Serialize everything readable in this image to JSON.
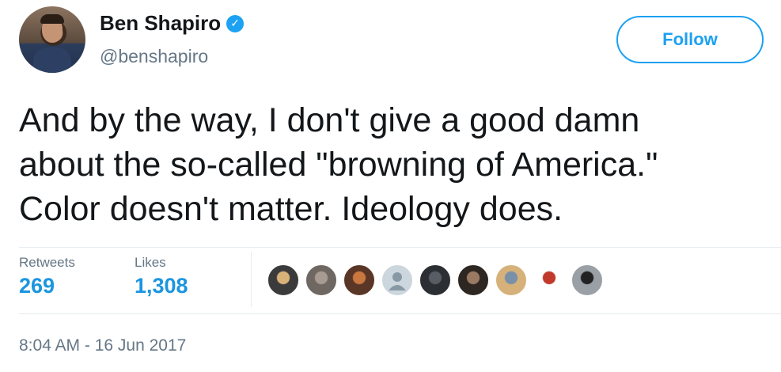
{
  "author": {
    "name": "Ben Shapiro",
    "handle": "@benshapiro",
    "verified_icon": "✓"
  },
  "follow_label": "Follow",
  "tweet_lines": [
    "And by the way, I don't give a good damn",
    "about the so-called \"browning of America.\"",
    "Color doesn't matter. Ideology does."
  ],
  "stats": {
    "retweets_label": "Retweets",
    "retweets_value": "269",
    "likes_label": "Likes",
    "likes_value": "1,308"
  },
  "likers": [
    {
      "icon": "liker-avatar-1",
      "color": "#3b3b3b",
      "accent": "#d9b27a"
    },
    {
      "icon": "liker-avatar-2",
      "color": "#6e6762",
      "accent": "#a89c92"
    },
    {
      "icon": "liker-avatar-3",
      "color": "#5a3626",
      "accent": "#c9763f"
    },
    {
      "icon": "default-user-icon",
      "color": "#ccd6dd",
      "accent": "#8899a6"
    },
    {
      "icon": "liker-avatar-5",
      "color": "#2b2e33",
      "accent": "#585d63"
    },
    {
      "icon": "liker-avatar-6",
      "color": "#2d2621",
      "accent": "#9a7a62"
    },
    {
      "icon": "liker-avatar-7",
      "color": "#d6b27a",
      "accent": "#7a8fa8"
    },
    {
      "icon": "liker-avatar-8",
      "color": "#ffffff",
      "accent": "#c0392b"
    },
    {
      "icon": "liker-avatar-9",
      "color": "#9aa0a6",
      "accent": "#222222"
    }
  ],
  "timestamp": "8:04 AM - 16 Jun 2017",
  "colors": {
    "accent": "#1da1f2",
    "count": "#1b95e0",
    "secondary_text": "#657786"
  }
}
